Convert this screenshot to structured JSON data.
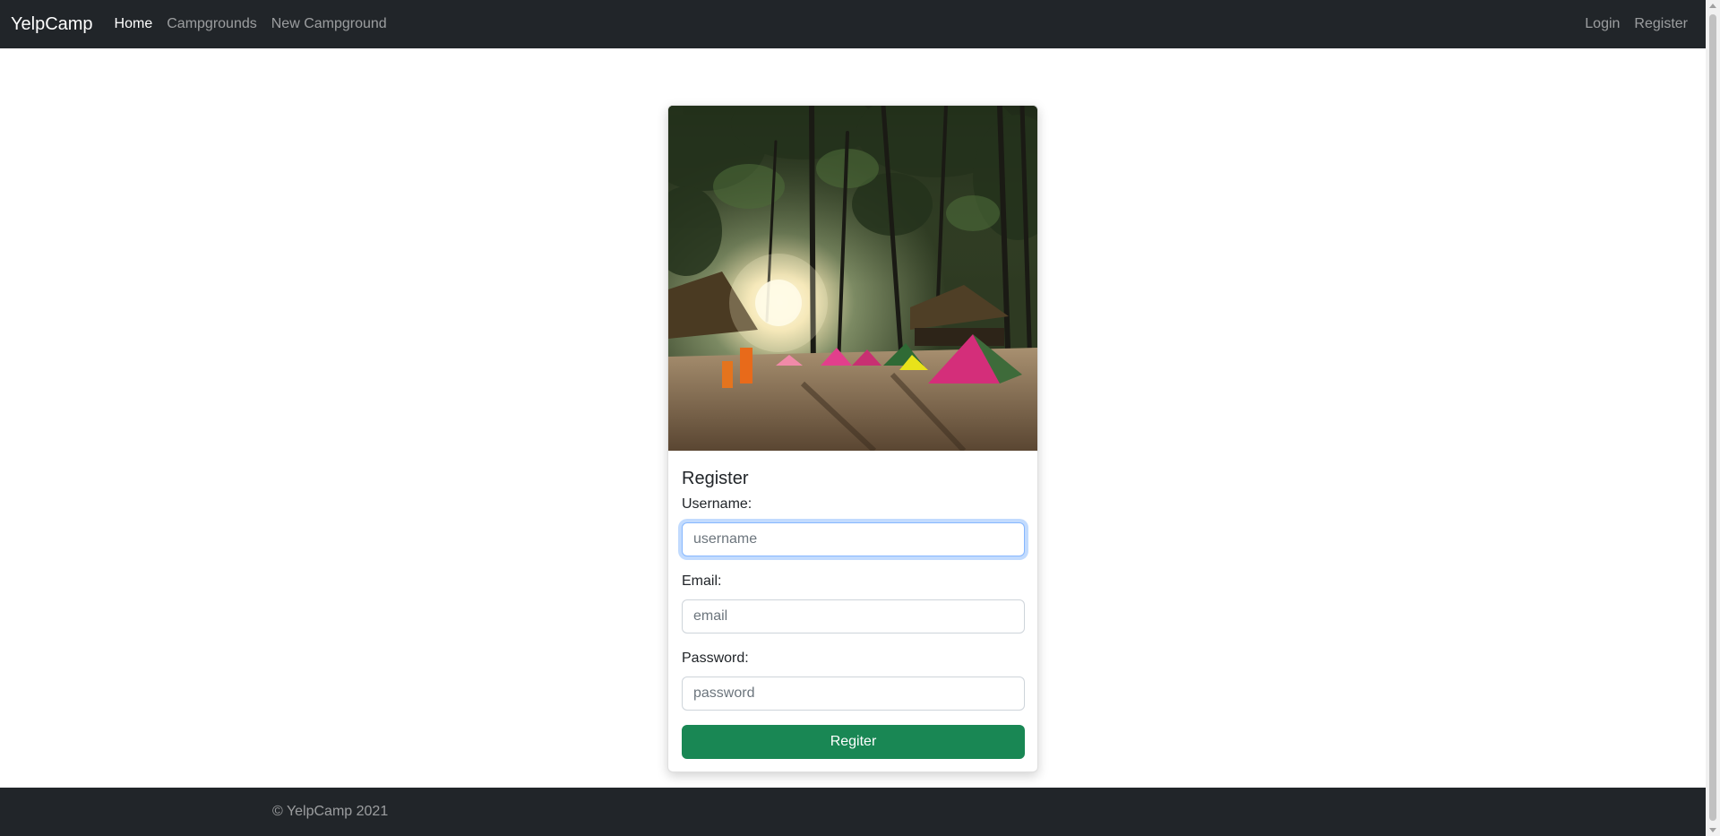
{
  "navbar": {
    "brand": "YelpCamp",
    "left_links": [
      {
        "label": "Home",
        "active": true
      },
      {
        "label": "Campgrounds",
        "active": false
      },
      {
        "label": "New Campground",
        "active": false
      }
    ],
    "right_links": [
      {
        "label": "Login"
      },
      {
        "label": "Register"
      }
    ]
  },
  "card": {
    "title": "Register",
    "fields": {
      "username": {
        "label": "Username:",
        "placeholder": "username",
        "value": ""
      },
      "email": {
        "label": "Email:",
        "placeholder": "email",
        "value": ""
      },
      "password": {
        "label": "Password:",
        "placeholder": "password",
        "value": ""
      }
    },
    "submit_label": "Regiter"
  },
  "footer": {
    "text": "© YelpCamp 2021"
  },
  "colors": {
    "navbar_bg": "#212529",
    "success": "#198754",
    "focus_border": "#86b7fe"
  }
}
